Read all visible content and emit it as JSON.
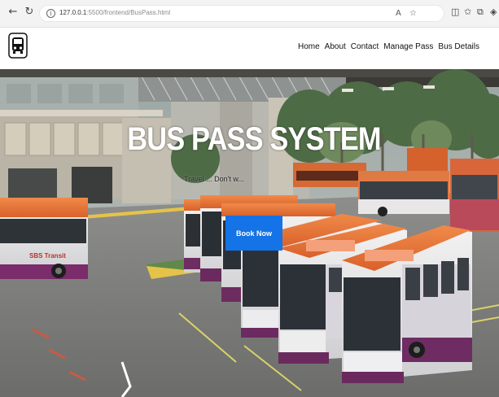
{
  "browser": {
    "url_host": "127.0.0.1",
    "url_rest": ":5500/frontend/BusPass.html",
    "back_icon": "back-arrow-icon",
    "refresh_icon": "refresh-icon"
  },
  "header": {
    "logo_icon": "bus-logo-icon",
    "nav": [
      "Home",
      "About",
      "Contact",
      "Manage Pass",
      "Bus Details"
    ]
  },
  "hero": {
    "title": "BUS PASS SYSTEM",
    "subtitle": "Travel ... Don't w...",
    "button_label": "Book Now",
    "button_color": "#1473e6"
  },
  "photo_text": {
    "bus_brand": "SBS Transit"
  }
}
